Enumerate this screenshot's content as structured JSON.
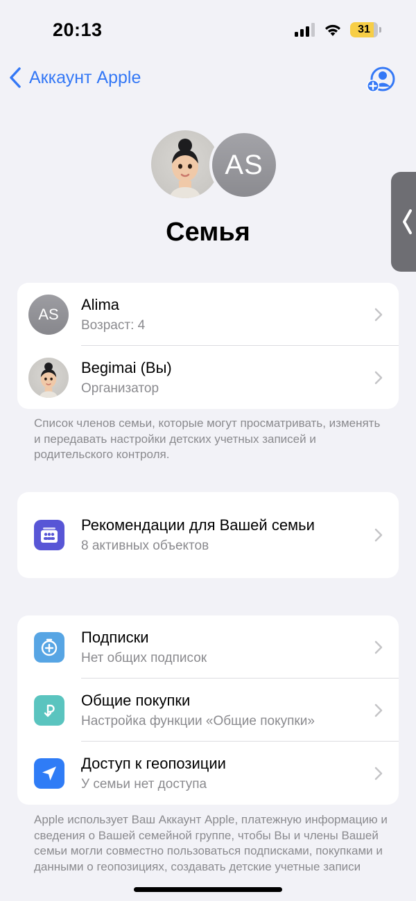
{
  "status_bar": {
    "time": "20:13",
    "battery": "31"
  },
  "nav": {
    "back_label": "Аккаунт Apple"
  },
  "header": {
    "avatar_initials": "AS",
    "title": "Семья"
  },
  "members": [
    {
      "initials": "AS",
      "name": "Alima",
      "subtitle": "Возраст: 4"
    },
    {
      "name": "Begimai (Вы)",
      "subtitle": "Организатор"
    }
  ],
  "members_footnote": "Список членов семьи, которые могут просматривать, изменять и передавать настройки детских учетных записей и родительского контроля.",
  "recommendations": {
    "title": "Рекомендации для Вашей семьи",
    "subtitle": "8 активных объектов"
  },
  "features": [
    {
      "title": "Подписки",
      "subtitle": "Нет общих подписок",
      "icon": "subscriptions-icon",
      "color": "#57a5e4"
    },
    {
      "title": "Общие покупки",
      "subtitle": "Настройка функции «Общие покупки»",
      "icon": "purchase-sharing-icon",
      "color": "#5ac4bf"
    },
    {
      "title": "Доступ к геопозиции",
      "subtitle": "У семьи нет доступа",
      "icon": "location-arrow-icon",
      "color": "#2f7cf6"
    }
  ],
  "features_footnote": "Apple использует Ваш Аккаунт Apple, платежную информацию и сведения о Вашей семейной группе, чтобы Вы и члены Вашей семьи могли совместно пользоваться подписками, покупками и данными о геопозициях, создавать детские учетные записи",
  "colors": {
    "accent": "#3478f6",
    "recommendations_icon": "#5856d6",
    "battery": "#f7ce46"
  }
}
